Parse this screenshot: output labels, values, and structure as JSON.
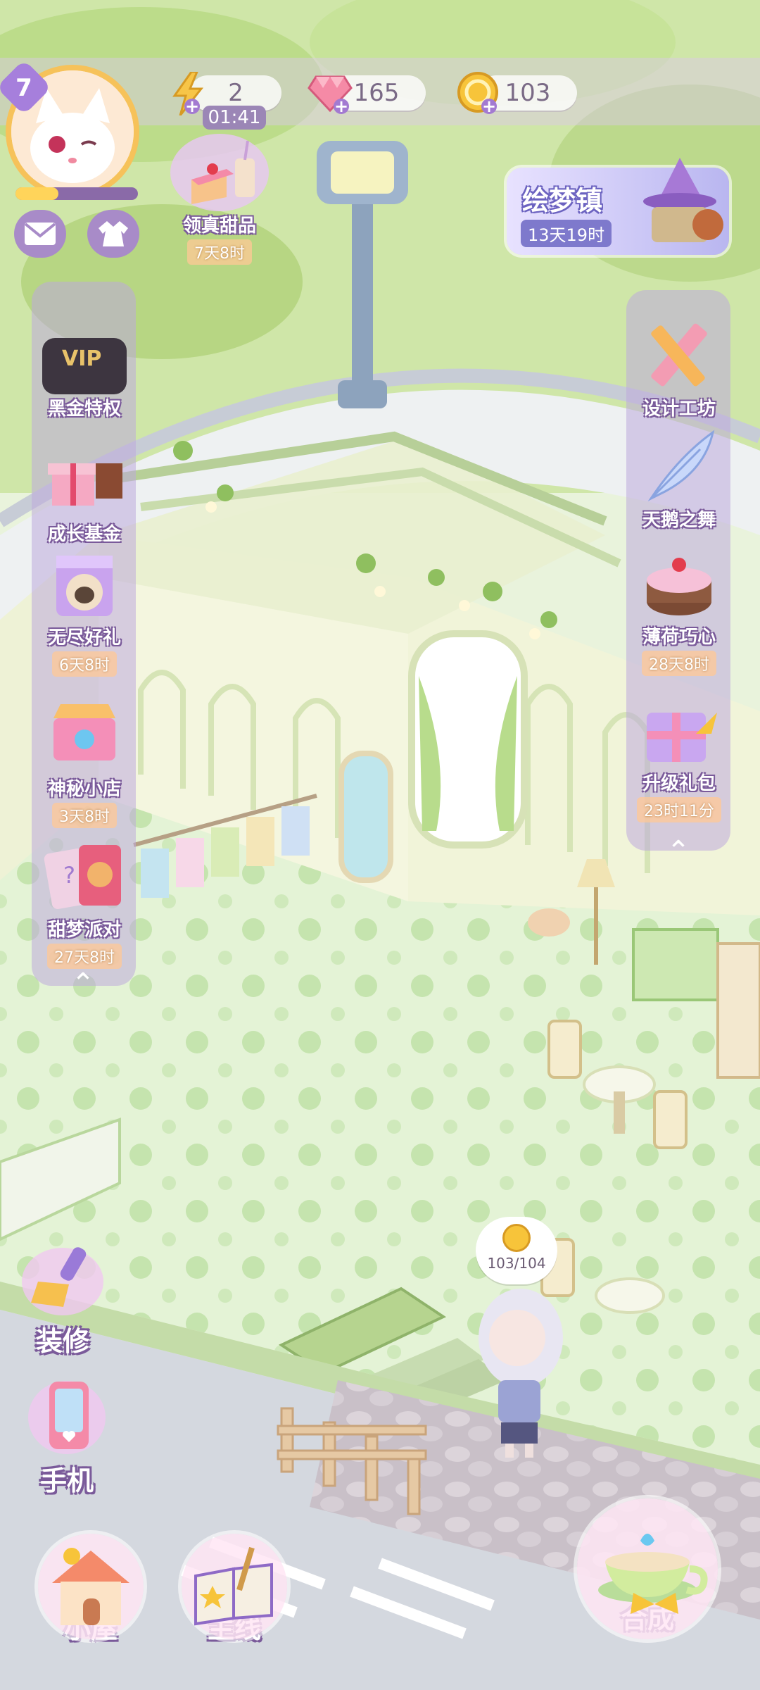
{
  "player": {
    "level": "7"
  },
  "resources": {
    "energy": {
      "value": "2",
      "timer": "01:41",
      "icon": "lightning-icon"
    },
    "gems": {
      "value": "165",
      "icon": "diamond-icon"
    },
    "coins": {
      "value": "103",
      "icon": "coin-icon"
    }
  },
  "top_events": {
    "dessert": {
      "label": "领真甜品",
      "timer": "7天8时"
    },
    "dream_town": {
      "label": "绘梦镇",
      "timer": "13天19时"
    }
  },
  "left_menu": [
    {
      "label": "黑金特权",
      "timer": ""
    },
    {
      "label": "成长基金",
      "timer": ""
    },
    {
      "label": "无尽好礼",
      "timer": "6天8时"
    },
    {
      "label": "神秘小店",
      "timer": "3天8时"
    },
    {
      "label": "甜梦派对",
      "timer": "27天8时"
    }
  ],
  "right_menu": [
    {
      "label": "设计工坊",
      "timer": ""
    },
    {
      "label": "天鹅之舞",
      "timer": ""
    },
    {
      "label": "薄荷巧心",
      "timer": "28天8时"
    },
    {
      "label": "升级礼包",
      "timer": "23时11分"
    }
  ],
  "vip_badge": "VIP",
  "side_actions": {
    "decorate": "装修",
    "phone": "手机"
  },
  "bottom_nav": {
    "house": "小屋",
    "main_story": "主线",
    "merge": "合成"
  },
  "coin_bubble": "103/104",
  "colors": {
    "accent": "#b08ad8",
    "panel": "#c8b0e0",
    "floor": "#d6eec4"
  }
}
